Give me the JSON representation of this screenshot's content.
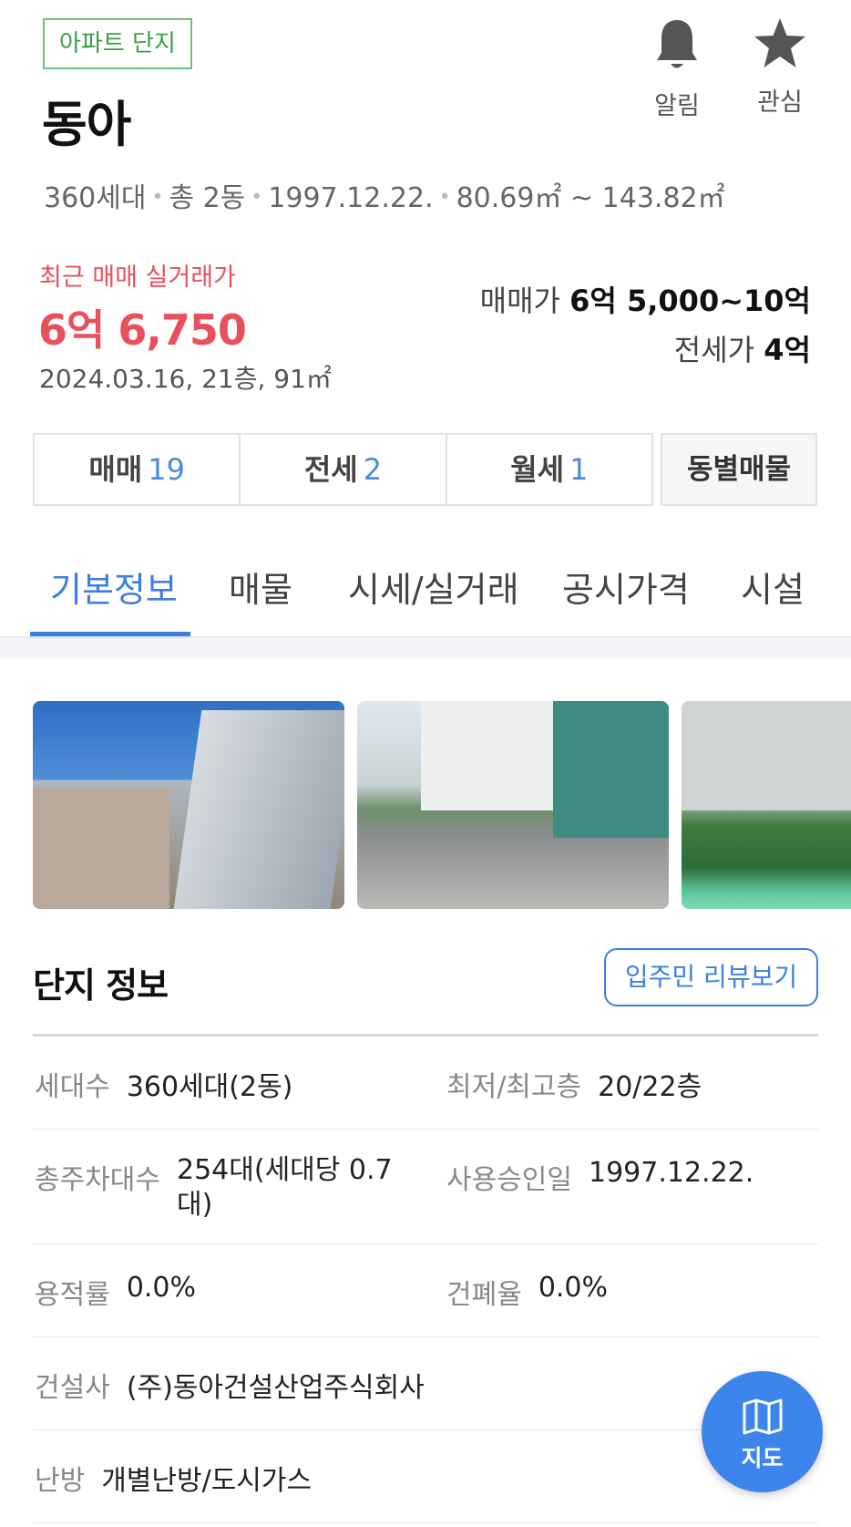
{
  "complex": {
    "tag": "아파트 단지",
    "name": "동아",
    "summary": [
      "360세대",
      "총 2동",
      "1997.12.22.",
      "80.69㎡ ~ 143.82㎡"
    ]
  },
  "header_actions": {
    "alarm": {
      "label": "알림",
      "icon": "bell-icon"
    },
    "favorite": {
      "label": "관심",
      "icon": "star-icon"
    }
  },
  "recent_trade": {
    "label": "최근 매매 실거래가",
    "price": "6억 6,750",
    "detail": "2024.03.16, 21층, 91㎡"
  },
  "price_range": {
    "sale_label": "매매가",
    "sale_value": "6억 5,000~10억",
    "jeonse_label": "전세가",
    "jeonse_value": "4억"
  },
  "listing_tabs": [
    {
      "label": "매매",
      "count": "19"
    },
    {
      "label": "전세",
      "count": "2"
    },
    {
      "label": "월세",
      "count": "1"
    }
  ],
  "dong_tab": "동별매물",
  "nav_tabs": [
    "기본정보",
    "매물",
    "시세/실거래",
    "공시가격",
    "시설"
  ],
  "section": {
    "title": "단지 정보",
    "review_button": "입주민 리뷰보기"
  },
  "info": {
    "households_label": "세대수",
    "households": "360세대(2동)",
    "floors_label": "최저/최고층",
    "floors": "20/22층",
    "parking_label": "총주차대수",
    "parking_line1": "254대(세대당 0.7",
    "parking_line2": "대)",
    "approval_label": "사용승인일",
    "approval": "1997.12.22.",
    "far_label": "용적률",
    "far": "0.0%",
    "bcr_label": "건폐율",
    "bcr": "0.0%",
    "builder_label": "건설사",
    "builder": "(주)동아건설산업주식회사",
    "heating_label": "난방",
    "heating": "개별난방/도시가스"
  },
  "map_button": {
    "label": "지도",
    "icon": "map-icon"
  },
  "colors": {
    "accent": "#3d7fe0",
    "price_red": "#e8505b",
    "tag_green": "#3a9d4b"
  }
}
